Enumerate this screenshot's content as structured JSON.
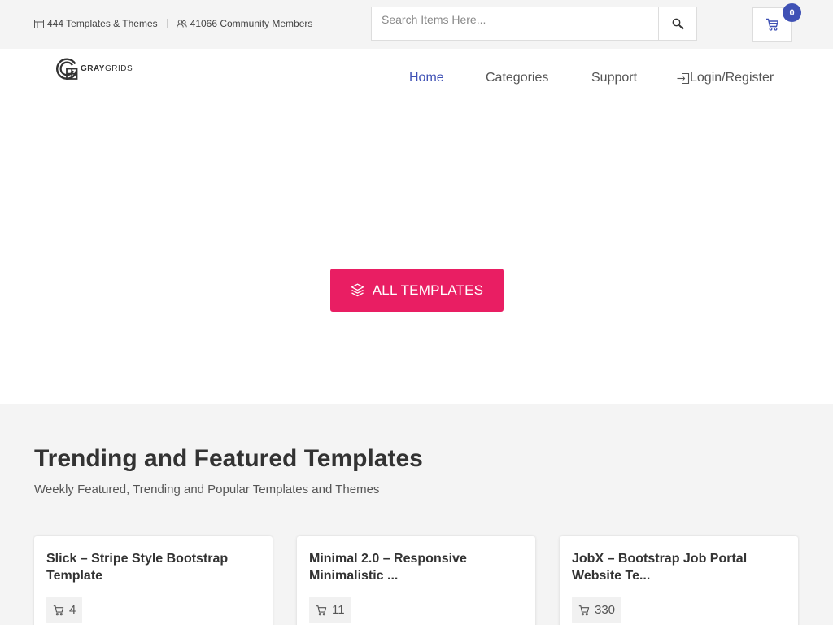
{
  "topbar": {
    "templates_count": "444 Templates & Themes",
    "members_count": "41066 Community Members",
    "search_placeholder": "Search Items Here...",
    "cart_count": "0"
  },
  "brand": {
    "logo_text_bold": "GRAY",
    "logo_text_light": "GRIDS"
  },
  "nav": {
    "items": [
      {
        "label": "Home",
        "active": true
      },
      {
        "label": "Categories"
      },
      {
        "label": "Support"
      },
      {
        "label": "Login/Register"
      }
    ]
  },
  "hero": {
    "cta_label": "ALL TEMPLATES"
  },
  "trending": {
    "title": "Trending and Featured Templates",
    "subtitle": "Weekly Featured, Trending and Popular Templates and Themes",
    "cards": [
      {
        "title": "Slick – Stripe Style Bootstrap Template",
        "sales": "4"
      },
      {
        "title": "Minimal 2.0 – Responsive Minimalistic ...",
        "sales": "11"
      },
      {
        "title": "JobX – Bootstrap Job Portal Website Te...",
        "sales": "330"
      }
    ]
  },
  "colors": {
    "accent": "#3f51b5",
    "cta": "#e91e63"
  }
}
